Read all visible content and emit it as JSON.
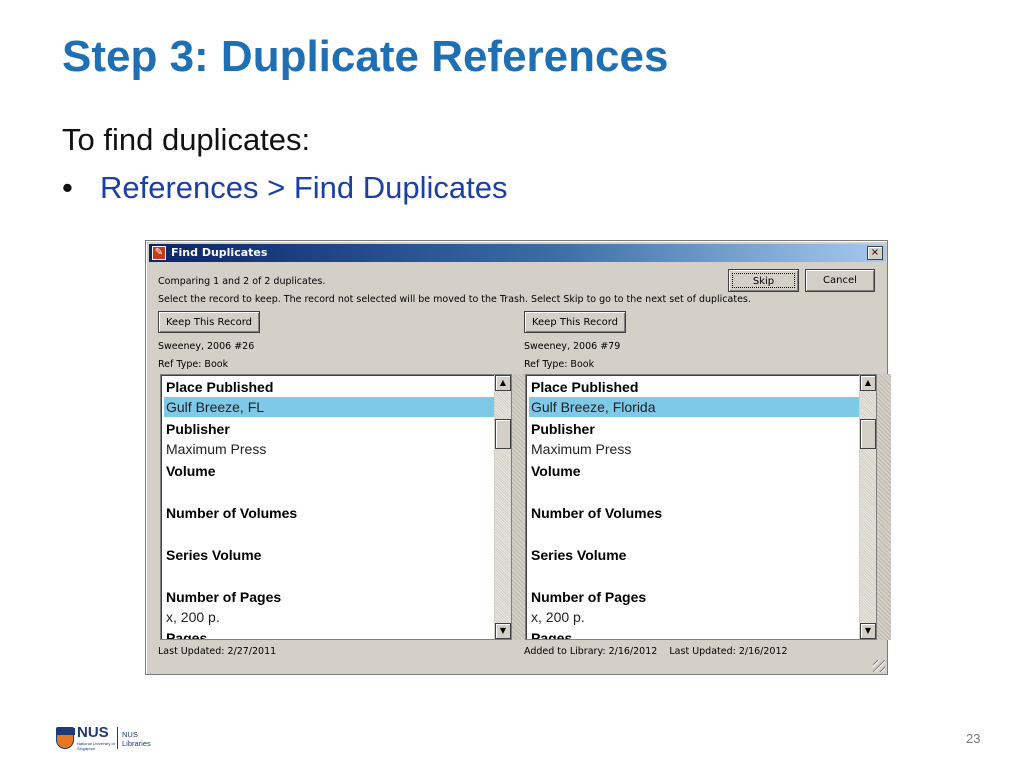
{
  "slide": {
    "title": "Step 3: Duplicate References",
    "intro": "To find duplicates:",
    "bullet_symbol": "•",
    "bullet_text": "References > Find Duplicates",
    "page_number": "23"
  },
  "dialog": {
    "title": "Find Duplicates",
    "close_glyph": "×",
    "comparing_text": "Comparing 1 and 2 of 2 duplicates.",
    "instruction_text": "Select the record to keep. The record not selected will be moved to the Trash. Select Skip to go to the next set of duplicates.",
    "skip_label": "Skip",
    "cancel_label": "Cancel",
    "scroll_up_glyph": "▲",
    "scroll_down_glyph": "▼",
    "left": {
      "keep_label": "Keep This Record",
      "citation": "Sweeney, 2006 #26",
      "ref_type": "Ref Type: Book",
      "fields": [
        {
          "label": "Place Published",
          "value": "Gulf Breeze, FL"
        },
        {
          "label": "Publisher",
          "value": "Maximum Press"
        },
        {
          "label": "Volume",
          "value": ""
        },
        {
          "label": "Number of Volumes",
          "value": ""
        },
        {
          "label": "Series Volume",
          "value": ""
        },
        {
          "label": "Number of Pages",
          "value": "x, 200 p."
        },
        {
          "label": "Pages",
          "value": ""
        }
      ],
      "status": "Last Updated: 2/27/2011"
    },
    "right": {
      "keep_label": "Keep This Record",
      "citation": "Sweeney, 2006 #79",
      "ref_type": "Ref Type: Book",
      "fields": [
        {
          "label": "Place Published",
          "value": "Gulf Breeze, Florida"
        },
        {
          "label": "Publisher",
          "value": "Maximum Press"
        },
        {
          "label": "Volume",
          "value": ""
        },
        {
          "label": "Number of Volumes",
          "value": ""
        },
        {
          "label": "Series Volume",
          "value": ""
        },
        {
          "label": "Number of Pages",
          "value": "x, 200 p."
        },
        {
          "label": "Pages",
          "value": ""
        }
      ],
      "status": "Added to Library: 2/16/2012    Last Updated: 2/16/2012"
    }
  },
  "footer": {
    "logo_word": "NUS",
    "logo_sub": "National University of Singapore",
    "library_line1": "NUS",
    "library_line2": "Libraries"
  },
  "colors": {
    "title_blue": "#1f6fb4",
    "bullet_blue": "#1a3fa8",
    "highlight": "#7ec8e8",
    "dialog_bg": "#d4d0c8"
  }
}
